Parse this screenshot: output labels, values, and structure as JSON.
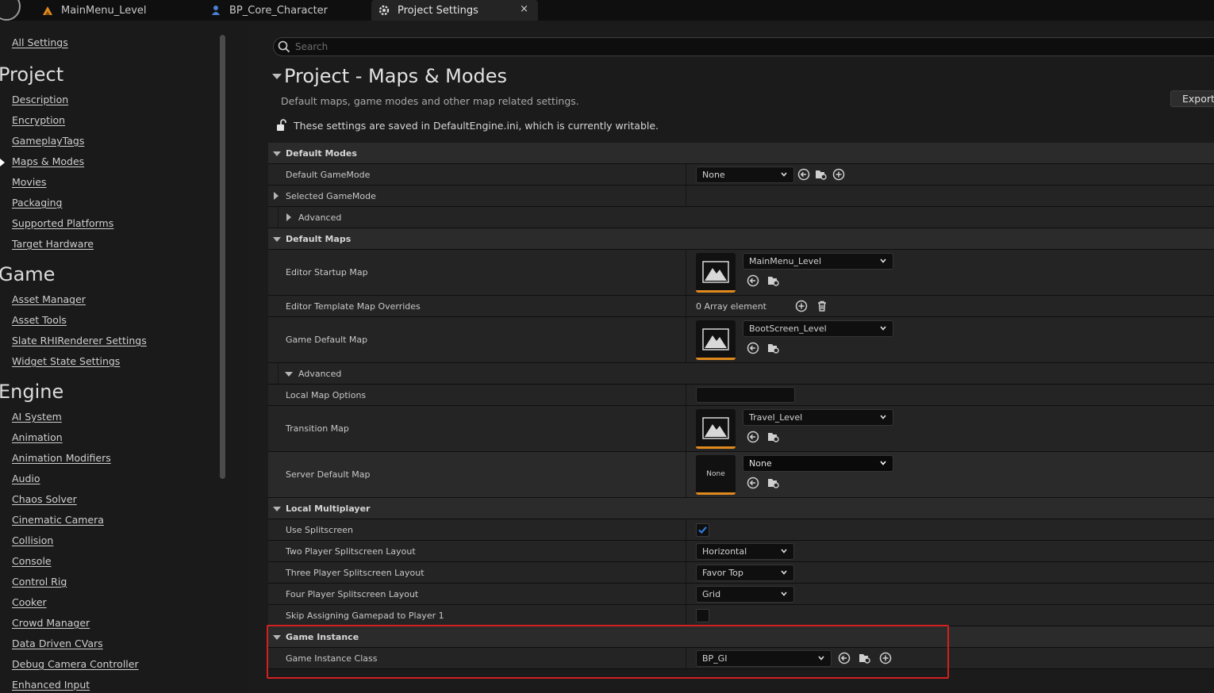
{
  "tabs": [
    {
      "label": "MainMenu_Level",
      "icon": "level-icon"
    },
    {
      "label": "BP_Core_Character",
      "icon": "character-icon"
    },
    {
      "label": "Project Settings",
      "icon": "settings-icon",
      "active": true
    }
  ],
  "tab_close_glyph": "×",
  "leftnav": {
    "all_settings": "All Settings",
    "categories": [
      {
        "title": "Project",
        "items": [
          "Description",
          "Encryption",
          "GameplayTags",
          "Maps & Modes",
          "Movies",
          "Packaging",
          "Supported Platforms",
          "Target Hardware"
        ]
      },
      {
        "title": "Game",
        "items": [
          "Asset Manager",
          "Asset Tools",
          "Slate RHIRenderer Settings",
          "Widget State Settings"
        ]
      },
      {
        "title": "Engine",
        "items": [
          "AI System",
          "Animation",
          "Animation Modifiers",
          "Audio",
          "Chaos Solver",
          "Cinematic Camera",
          "Collision",
          "Console",
          "Control Rig",
          "Cooker",
          "Crowd Manager",
          "Data Driven CVars",
          "Debug Camera Controller",
          "Enhanced Input"
        ]
      }
    ],
    "selected": "Maps & Modes"
  },
  "search": {
    "placeholder": "Search"
  },
  "page": {
    "title": "Project - Maps & Modes",
    "subtitle": "Default maps, game modes and other map related settings.",
    "writable_note": "These settings are saved in DefaultEngine.ini, which is currently writable.",
    "export_label": "Export..."
  },
  "settings": {
    "default_modes": {
      "header": "Default Modes",
      "default_gamemode_label": "Default GameMode",
      "default_gamemode_value": "None",
      "selected_gamemode_label": "Selected GameMode",
      "advanced_label": "Advanced"
    },
    "default_maps": {
      "header": "Default Maps",
      "editor_startup_label": "Editor Startup Map",
      "editor_startup_value": "MainMenu_Level",
      "template_overrides_label": "Editor Template Map Overrides",
      "template_overrides_value": "0 Array element",
      "game_default_label": "Game Default Map",
      "game_default_value": "BootScreen_Level",
      "advanced_label": "Advanced",
      "local_map_options_label": "Local Map Options",
      "local_map_options_value": "",
      "transition_label": "Transition Map",
      "transition_value": "Travel_Level",
      "server_default_label": "Server Default Map",
      "server_default_value": "None",
      "server_thumb_text": "None"
    },
    "local_multiplayer": {
      "header": "Local Multiplayer",
      "use_splitscreen_label": "Use Splitscreen",
      "use_splitscreen_checked": true,
      "two_player_label": "Two Player Splitscreen Layout",
      "two_player_value": "Horizontal",
      "three_player_label": "Three Player Splitscreen Layout",
      "three_player_value": "Favor Top",
      "four_player_label": "Four Player Splitscreen Layout",
      "four_player_value": "Grid",
      "skip_gamepad_label": "Skip Assigning Gamepad to Player 1",
      "skip_gamepad_checked": false
    },
    "game_instance": {
      "header": "Game Instance",
      "class_label": "Game Instance Class",
      "class_value": "BP_GI"
    }
  },
  "colors": {
    "accent_orange": "#e08a1e",
    "checkbox_blue": "#2d7be0",
    "highlight_red": "#d42020"
  }
}
